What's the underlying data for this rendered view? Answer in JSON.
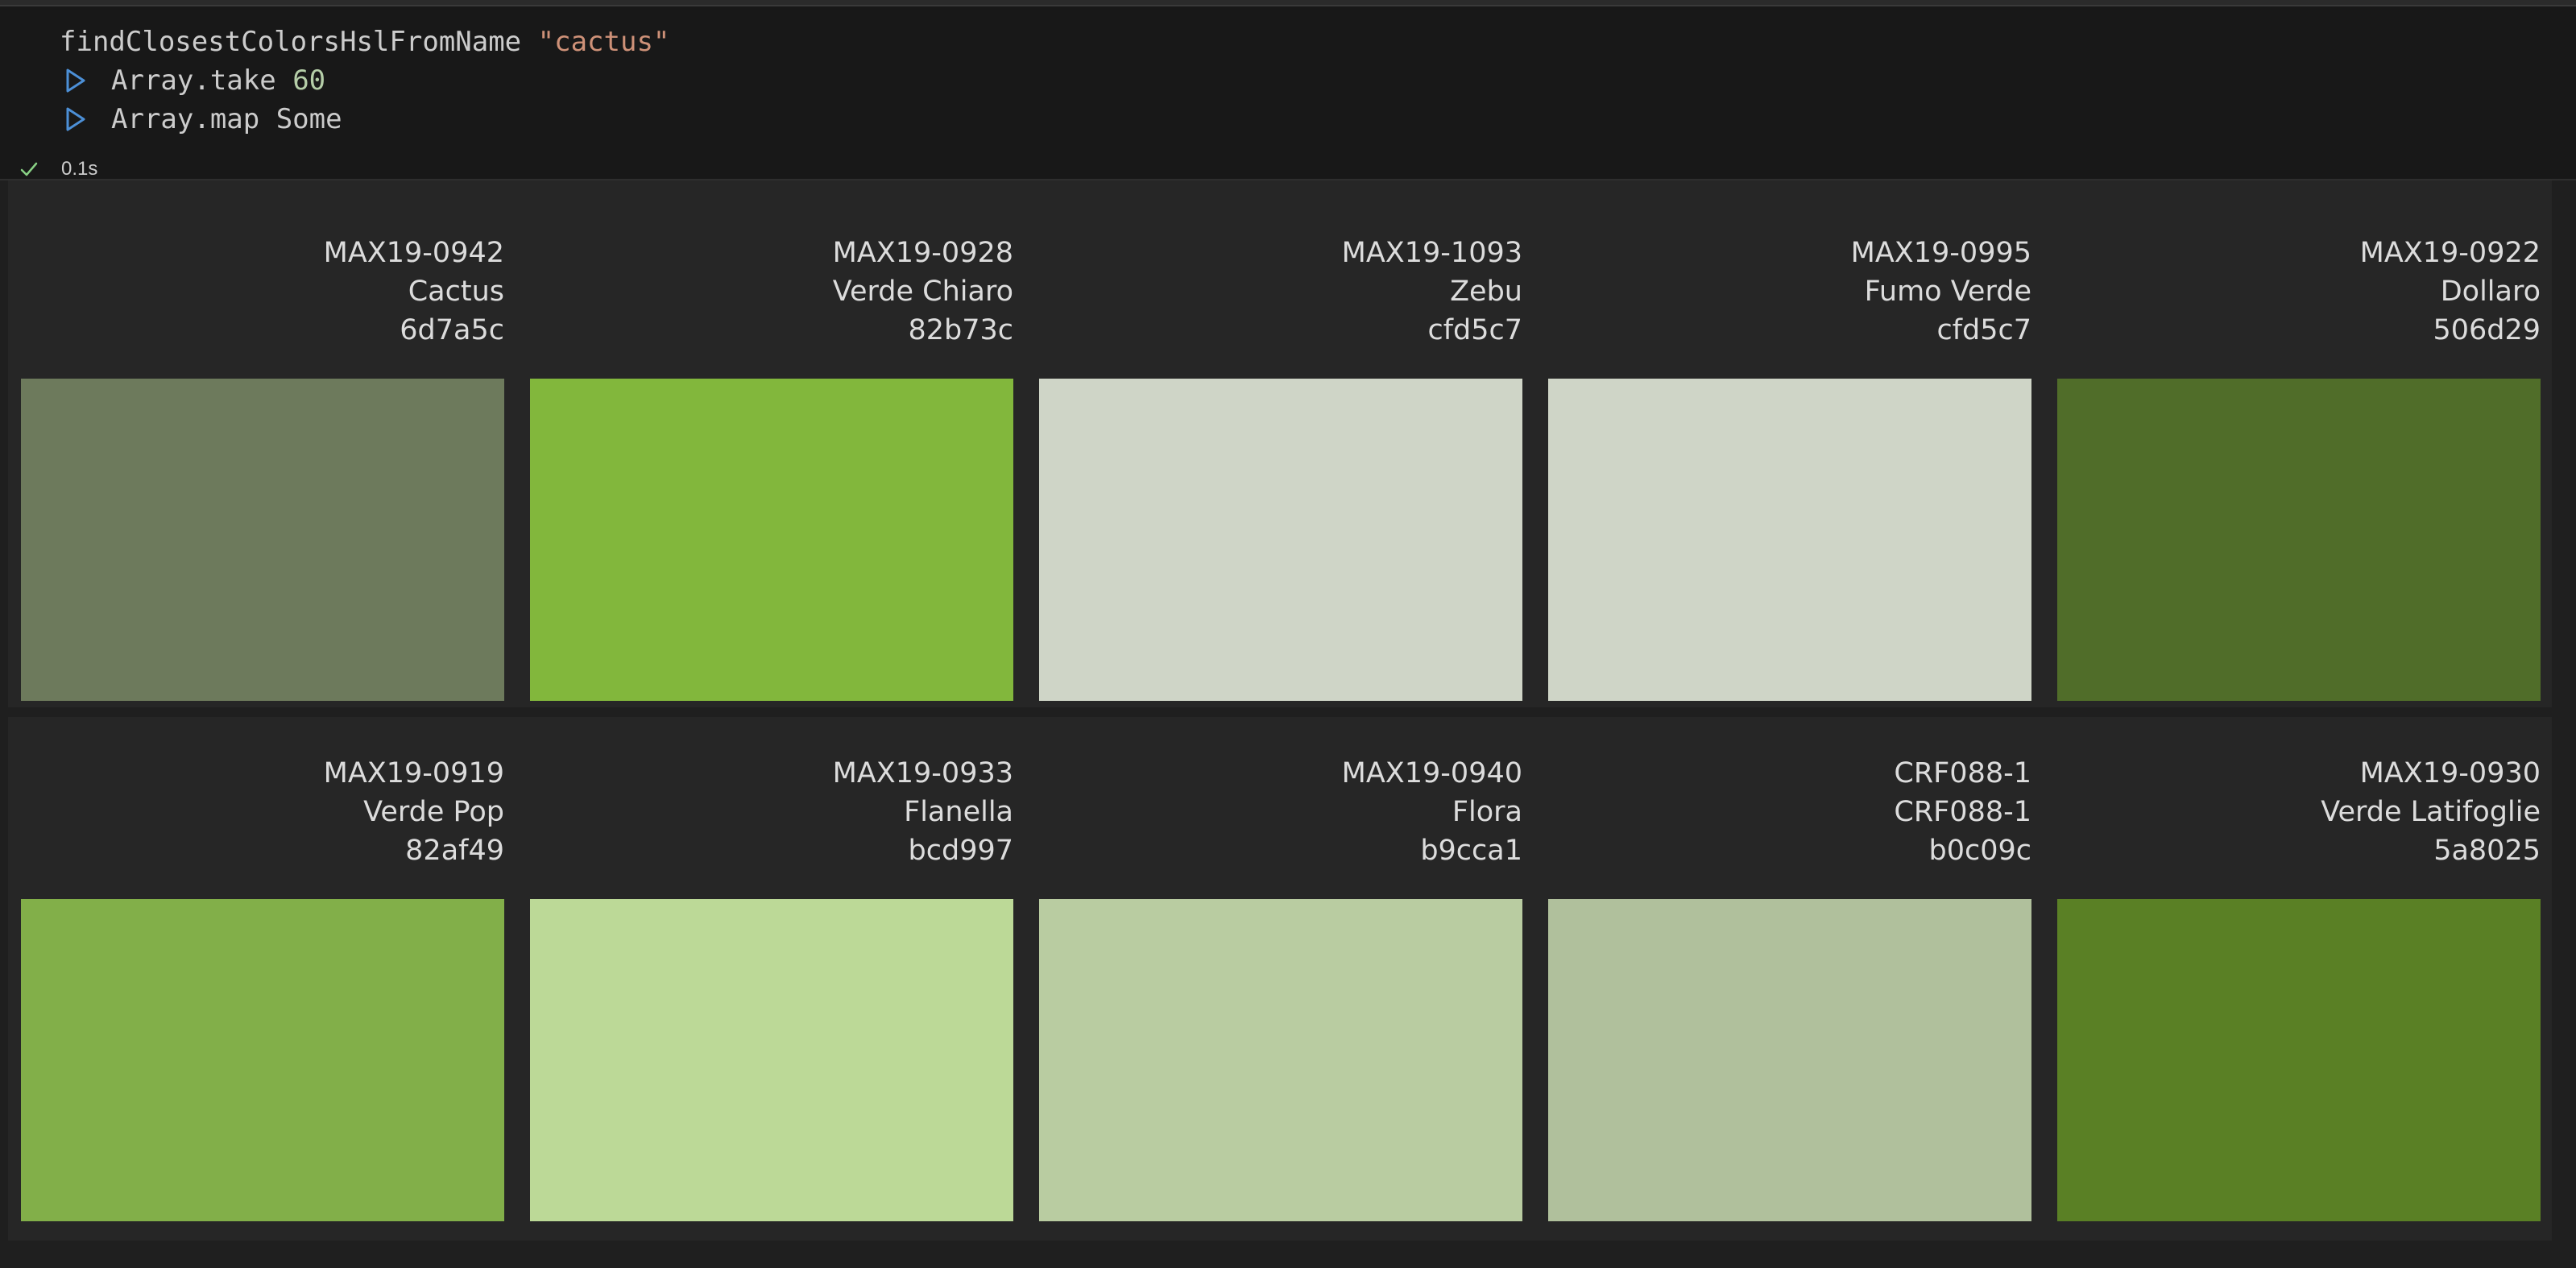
{
  "code": {
    "line1_fn": "findClosestColorsHslFromName",
    "line1_arg": "\"cactus\"",
    "line2_fn": "Array.take",
    "line2_arg": "60",
    "line3": "Array.map Some"
  },
  "status": {
    "time": "0.1s",
    "icon": "check-icon"
  },
  "icons": {
    "fold": "play-triangle-icon",
    "success": "check-icon"
  },
  "colors": {
    "keyword_fn": "#cccccc",
    "string": "#ce9178",
    "number": "#b5cea8",
    "fold_icon": "#4c8fd6",
    "check_icon": "#89d185"
  },
  "swatches": [
    {
      "code": "MAX19-0942",
      "name": "Cactus",
      "hex": "6d7a5c"
    },
    {
      "code": "MAX19-0928",
      "name": "Verde Chiaro",
      "hex": "82b73c"
    },
    {
      "code": "MAX19-1093",
      "name": "Zebu",
      "hex": "cfd5c7"
    },
    {
      "code": "MAX19-0995",
      "name": "Fumo Verde",
      "hex": "cfd5c7"
    },
    {
      "code": "MAX19-0922",
      "name": "Dollaro",
      "hex": "506d29"
    },
    {
      "code": "MAX19-0919",
      "name": "Verde Pop",
      "hex": "82af49"
    },
    {
      "code": "MAX19-0933",
      "name": "Flanella",
      "hex": "bcd997"
    },
    {
      "code": "MAX19-0940",
      "name": "Flora",
      "hex": "b9cca1"
    },
    {
      "code": "CRF088-1",
      "name": "CRF088-1",
      "hex": "b0c09c"
    },
    {
      "code": "MAX19-0930",
      "name": "Verde Latifoglie",
      "hex": "5a8025"
    }
  ]
}
